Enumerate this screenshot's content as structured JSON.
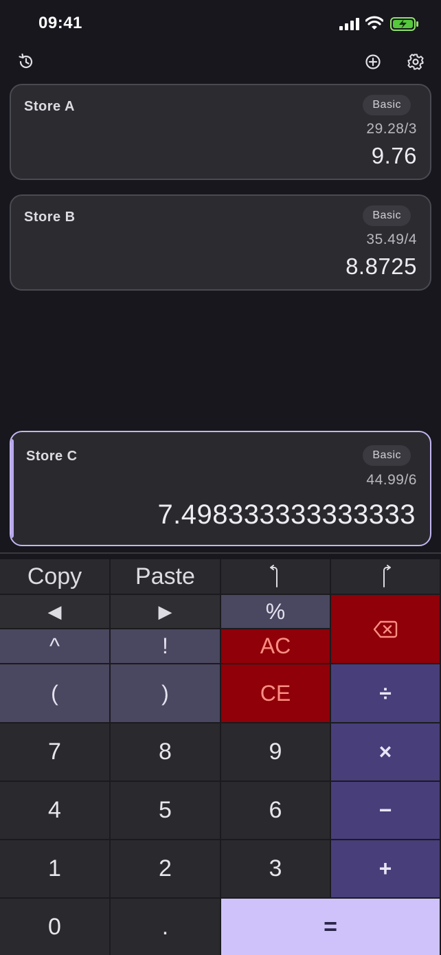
{
  "status": {
    "time": "09:41"
  },
  "cards": [
    {
      "title": "Store A",
      "mode": "Basic",
      "expression": "29.28/3",
      "result": "9.76"
    },
    {
      "title": "Store B",
      "mode": "Basic",
      "expression": "35.49/4",
      "result": "8.8725"
    },
    {
      "title": "Store C",
      "mode": "Basic",
      "expression": "44.99/6",
      "result": "7.498333333333333"
    }
  ],
  "keypad": {
    "copy": "Copy",
    "paste": "Paste",
    "undo": "↶",
    "redo": "↷",
    "left": "◀",
    "right": "▶",
    "percent": "%",
    "power": "^",
    "factorial": "!",
    "ac": "AC",
    "paren_open": "(",
    "paren_close": ")",
    "ce": "CE",
    "divide": "÷",
    "multiply": "×",
    "minus": "−",
    "plus": "+",
    "equals": "=",
    "decimal": ".",
    "digits": [
      "0",
      "1",
      "2",
      "3",
      "4",
      "5",
      "6",
      "7",
      "8",
      "9"
    ]
  },
  "colors": {
    "accent": "#cfc2fb",
    "operator": "#473e7a",
    "danger": "#8f0008"
  },
  "icons": {
    "toolbar_left": "history-icon",
    "toolbar_add": "add-circle-icon",
    "toolbar_settings": "gear-icon",
    "backspace": "backspace-icon"
  }
}
